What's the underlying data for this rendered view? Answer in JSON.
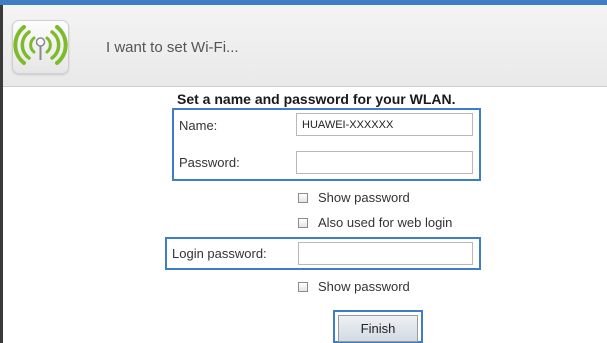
{
  "header": {
    "title": "I want to set Wi-Fi...",
    "icon": "wifi-signal-icon"
  },
  "form": {
    "section_title": "Set a name and password for your WLAN.",
    "name_label": "Name:",
    "name_value": "HUAWEI-XXXXXX",
    "password_label": "Password:",
    "password_value": "",
    "show_password_label": "Show password",
    "show_password_checked": false,
    "also_web_login_label": "Also used for web login",
    "also_web_login_checked": false,
    "login_password_label": "Login password:",
    "login_password_value": "",
    "show_login_password_label": "Show password",
    "show_login_password_checked": false,
    "finish_label": "Finish"
  },
  "colors": {
    "accent": "#3f7ec3",
    "wifi_green": "#7dbb2d"
  }
}
